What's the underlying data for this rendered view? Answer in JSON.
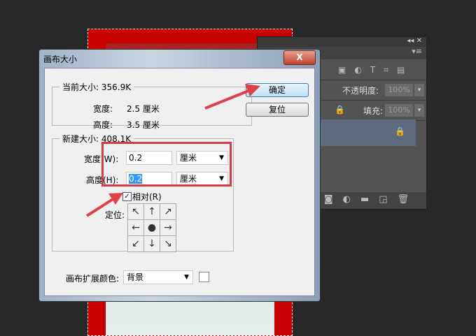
{
  "dialog": {
    "title": "画布大小",
    "close": "X",
    "current": {
      "legend": "当前大小: 356.9K",
      "width_label": "宽度:",
      "width_value": "2.5 厘米",
      "height_label": "高度:",
      "height_value": "3.5 厘米"
    },
    "new": {
      "legend": "新建大小: 408.1K",
      "width_label": "宽度(W):",
      "width_value": "0.2",
      "width_unit": "厘米",
      "height_label": "高度(H):",
      "height_value": "0.2",
      "height_unit": "厘米",
      "relative_label": "相对(R)",
      "relative_checked": true,
      "anchor_label": "定位:",
      "anchor_arrows": [
        "↖",
        "↑",
        "↗",
        "←",
        "●",
        "→",
        "↙",
        "↓",
        "↘"
      ]
    },
    "ok": "确定",
    "reset": "复位",
    "extension_color_label": "画布扩展颜色:",
    "extension_color_value": "背景"
  },
  "panel": {
    "collapse": "◂◂",
    "close": "✕",
    "menu": "▾≡",
    "opacity_label": "不透明度:",
    "opacity_value": "100%",
    "fill_label": "填充:",
    "fill_value": "100%",
    "filter_icons": [
      "▣",
      "◐",
      "T",
      "⌗",
      "▤"
    ],
    "bottom_icons": [
      "◙",
      "◐",
      "▬",
      "◲",
      "🗑"
    ]
  },
  "colors": {
    "annotation": "#d83a48",
    "layer_selected": "#5d6a80"
  }
}
